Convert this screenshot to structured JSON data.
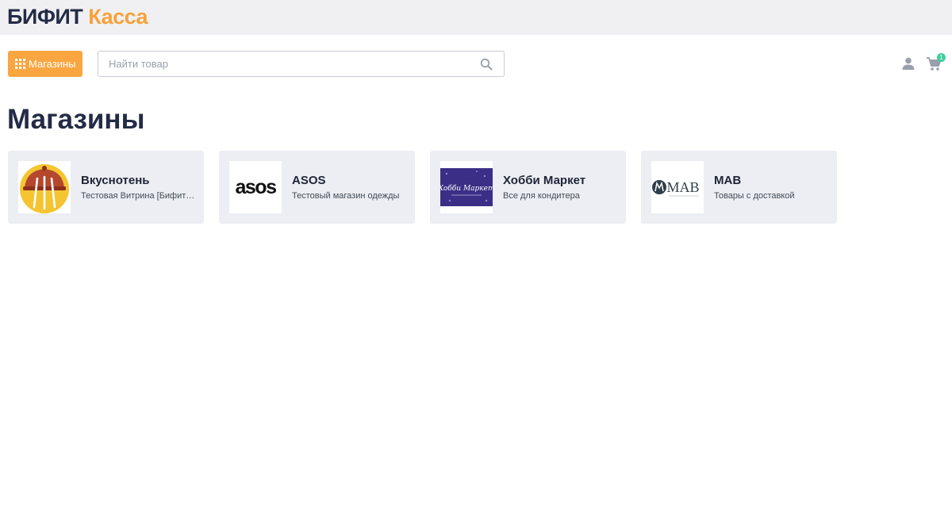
{
  "header": {
    "logo_part1": "БИФИТ",
    "logo_part2": "Касса"
  },
  "toolbar": {
    "shops_label": "Магазины",
    "search_placeholder": "Найти товар",
    "search_value": "",
    "cart_count": "1"
  },
  "main": {
    "title": "Магазины",
    "stores": [
      {
        "name": "Вкуснотень",
        "description": "Тестовая Витрина [Бифит Касса]",
        "logo": "restaurant-cloche-logo"
      },
      {
        "name": "ASOS",
        "description": "Тестовый магазин одежды",
        "logo": "asos-logo",
        "logo_text": "asos"
      },
      {
        "name": "Хобби Маркет",
        "description": "Все для кондитера",
        "logo": "hobby-market-logo",
        "logo_text": "Хобби Маркет"
      },
      {
        "name": "MAB",
        "description": "Товары с доставкой",
        "logo": "mab-logo",
        "logo_text": "MAB"
      }
    ]
  },
  "colors": {
    "accent": "#f9a640",
    "brand_dark": "#232b45",
    "card_bg": "#eceef3",
    "badge": "#3ecf9a"
  }
}
